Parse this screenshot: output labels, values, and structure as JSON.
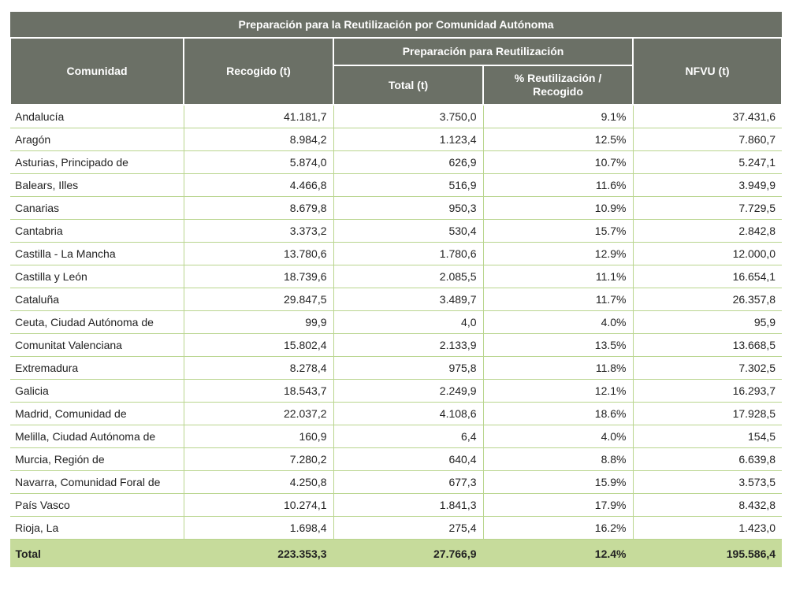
{
  "table": {
    "title": "Preparación para la Reutilización por Comunidad Autónoma",
    "headers": {
      "comunidad": "Comunidad",
      "recogido": "Recogido (t)",
      "group": "Preparación para Reutilización",
      "total": "Total (t)",
      "pct_line1": "% Reutilización /",
      "pct_line2": "Recogido",
      "nfvu": "NFVU (t)"
    },
    "rows": [
      [
        "Andalucía",
        "41.181,7",
        "3.750,0",
        "9.1%",
        "37.431,6"
      ],
      [
        "Aragón",
        "8.984,2",
        "1.123,4",
        "12.5%",
        "7.860,7"
      ],
      [
        "Asturias, Principado de",
        "5.874,0",
        "626,9",
        "10.7%",
        "5.247,1"
      ],
      [
        "Balears, Illes",
        "4.466,8",
        "516,9",
        "11.6%",
        "3.949,9"
      ],
      [
        "Canarias",
        "8.679,8",
        "950,3",
        "10.9%",
        "7.729,5"
      ],
      [
        "Cantabria",
        "3.373,2",
        "530,4",
        "15.7%",
        "2.842,8"
      ],
      [
        "Castilla - La Mancha",
        "13.780,6",
        "1.780,6",
        "12.9%",
        "12.000,0"
      ],
      [
        "Castilla y León",
        "18.739,6",
        "2.085,5",
        "11.1%",
        "16.654,1"
      ],
      [
        "Cataluña",
        "29.847,5",
        "3.489,7",
        "11.7%",
        "26.357,8"
      ],
      [
        "Ceuta, Ciudad Autónoma de",
        "99,9",
        "4,0",
        "4.0%",
        "95,9"
      ],
      [
        "Comunitat Valenciana",
        "15.802,4",
        "2.133,9",
        "13.5%",
        "13.668,5"
      ],
      [
        "Extremadura",
        "8.278,4",
        "975,8",
        "11.8%",
        "7.302,5"
      ],
      [
        "Galicia",
        "18.543,7",
        "2.249,9",
        "12.1%",
        "16.293,7"
      ],
      [
        "Madrid, Comunidad de",
        "22.037,2",
        "4.108,6",
        "18.6%",
        "17.928,5"
      ],
      [
        "Melilla, Ciudad Autónoma de",
        "160,9",
        "6,4",
        "4.0%",
        "154,5"
      ],
      [
        "Murcia, Región de",
        "7.280,2",
        "640,4",
        "8.8%",
        "6.639,8"
      ],
      [
        "Navarra, Comunidad Foral de",
        "4.250,8",
        "677,3",
        "15.9%",
        "3.573,5"
      ],
      [
        "País Vasco",
        "10.274,1",
        "1.841,3",
        "17.9%",
        "8.432,8"
      ],
      [
        "Rioja, La",
        "1.698,4",
        "275,4",
        "16.2%",
        "1.423,0"
      ]
    ],
    "total": [
      "Total",
      "223.353,3",
      "27.766,9",
      "12.4%",
      "195.586,4"
    ]
  },
  "colors": {
    "header_bg": "#6b7066",
    "row_border": "#b9d58e",
    "total_bg": "#c6db9b"
  }
}
